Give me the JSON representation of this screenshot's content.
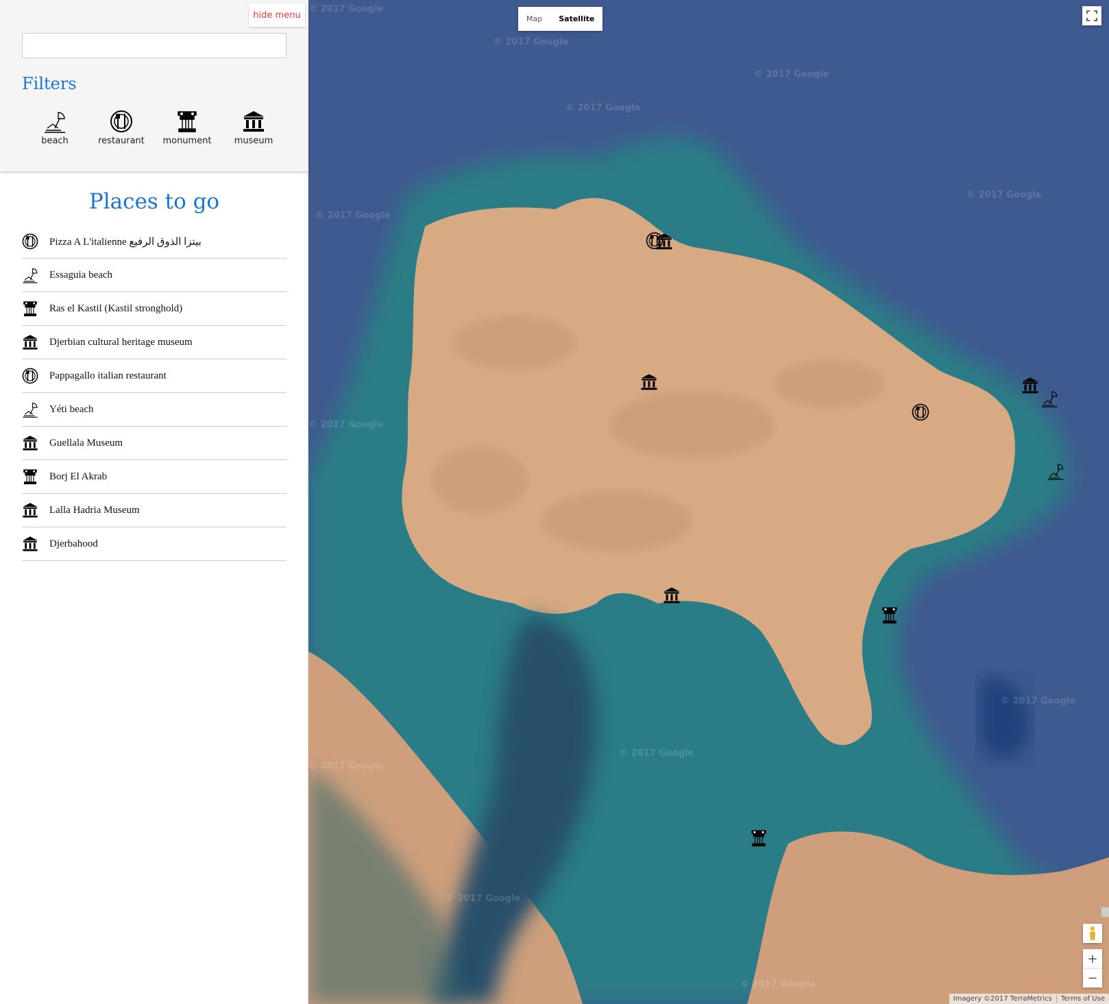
{
  "sidebar": {
    "hide_menu_label": "hide menu",
    "search": {
      "value": "",
      "placeholder": ""
    },
    "filters_title": "Filters",
    "filters": [
      {
        "label": "beach",
        "icon": "beach-icon"
      },
      {
        "label": "restaurant",
        "icon": "restaurant-icon"
      },
      {
        "label": "monument",
        "icon": "monument-icon"
      },
      {
        "label": "museum",
        "icon": "museum-icon"
      }
    ],
    "places_title": "Places to go",
    "places": [
      {
        "name": "Pizza A L'italienne بيتزا الذوق الرفيع",
        "icon": "restaurant-icon"
      },
      {
        "name": "Essaguia beach",
        "icon": "beach-icon"
      },
      {
        "name": "Ras el Kastil (Kastil stronghold)",
        "icon": "monument-icon"
      },
      {
        "name": "Djerbian cultural heritage museum",
        "icon": "museum-icon"
      },
      {
        "name": "Pappagallo italian restaurant",
        "icon": "restaurant-icon"
      },
      {
        "name": "Yéti beach",
        "icon": "beach-icon"
      },
      {
        "name": "Guellala Museum",
        "icon": "museum-icon"
      },
      {
        "name": "Borj El Akrab",
        "icon": "monument-icon"
      },
      {
        "name": "Lalla Hadria Museum",
        "icon": "museum-icon"
      },
      {
        "name": "Djerbahood",
        "icon": "museum-icon"
      }
    ]
  },
  "map": {
    "type_buttons": [
      {
        "label": "Map",
        "active": false
      },
      {
        "label": "Satellite",
        "active": true
      }
    ],
    "watermark": "© 2017 Google",
    "attribution": "Imagery ©2017 TerraMetrics",
    "terms": "Terms of Use",
    "zoom_in": "+",
    "zoom_out": "−",
    "colors": {
      "sea": "#3f5a8f",
      "shallow": "#2d7e86",
      "land": "#dcae86",
      "accent": "#1976d2",
      "hide_menu": "#e53935"
    }
  }
}
